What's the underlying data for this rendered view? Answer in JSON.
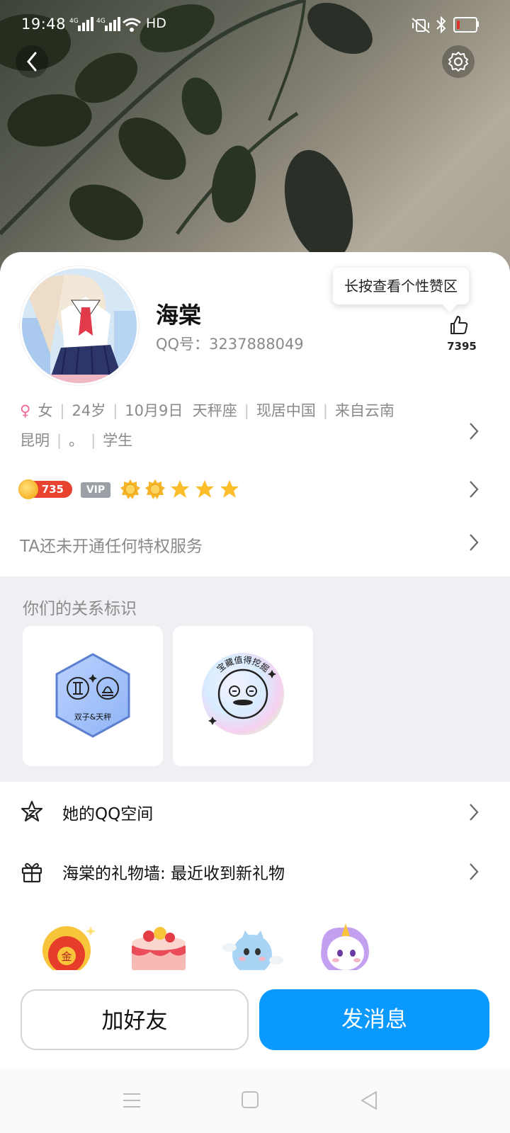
{
  "status_bar": {
    "time": "19:48",
    "network": "4G 4G",
    "hd": "HD"
  },
  "header": {
    "back_icon": "chevron-left-icon",
    "settings_icon": "gear-icon"
  },
  "profile": {
    "name": "海棠",
    "qq_number": "QQ号：3237888049",
    "tooltip": "长按查看个性赞区",
    "like_count": "7395"
  },
  "info": {
    "gender_symbol": "♀",
    "gender": "女",
    "age": "24岁",
    "birthday": "10月9日",
    "constellation": "天秤座",
    "residence": "现居中国",
    "hometown_a": "来自云南",
    "hometown_b": "昆明",
    "note": "。",
    "occupation": "学生"
  },
  "level": {
    "number": "735",
    "vip_label": "VIP",
    "icons": [
      "sun-icon",
      "sun-icon",
      "star-icon",
      "star-icon",
      "star-icon"
    ]
  },
  "privilege_text": "TA还未开通任何特权服务",
  "relationship": {
    "title": "你们的关系标识",
    "badges": [
      {
        "label": "双子&天秤"
      },
      {
        "label": "宝藏值得挖掘"
      }
    ]
  },
  "menu": {
    "qzone": "她的QQ空间",
    "gift_wall": "海棠的礼物墙: 最近收到新礼物"
  },
  "actions": {
    "add_friend": "加好友",
    "send_message": "发消息"
  },
  "colors": {
    "primary_blue": "#0a99ff",
    "level_red": "#e8432e",
    "gender_pink": "#f2679c"
  }
}
